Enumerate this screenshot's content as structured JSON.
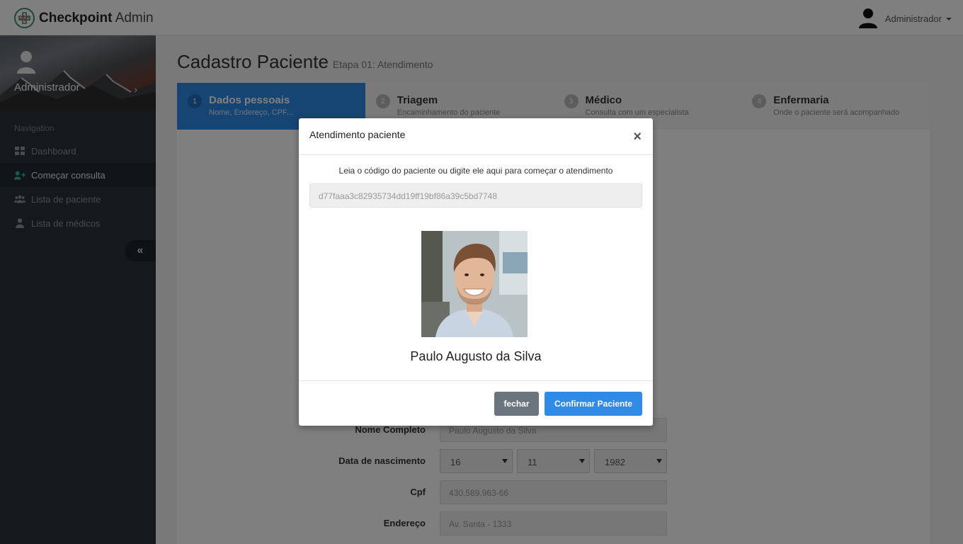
{
  "app": {
    "brand_bold": "Checkpoint",
    "brand_light": "Admin",
    "user_name": "Administrador"
  },
  "sidebar": {
    "profile_name": "Administrador",
    "nav_title": "Navigation",
    "items": [
      {
        "label": "Dashboard",
        "icon": "dashboard-icon"
      },
      {
        "label": "Começar consulta",
        "icon": "add-user-icon"
      },
      {
        "label": "Lista de paciente",
        "icon": "users-icon"
      },
      {
        "label": "Lista de médicos",
        "icon": "doctor-icon"
      }
    ]
  },
  "main": {
    "title": "Cadastro Paciente",
    "subtitle": "Etapa 01: Atendimento",
    "steps": [
      {
        "num": "1",
        "title": "Dados pessoais",
        "desc": "Nome, Endereço, CPF..."
      },
      {
        "num": "2",
        "title": "Triagem",
        "desc": "Encaminhamento do paciente"
      },
      {
        "num": "3",
        "title": "Médico",
        "desc": "Consulta com um especialista"
      },
      {
        "num": "4",
        "title": "Enfermaria",
        "desc": "Onde o paciente será acompanhado"
      }
    ],
    "form": {
      "name_label": "Nome Completo",
      "name_value": "Paulo Augusto da Silva",
      "birth_label": "Data de nascimento",
      "birth_day": "16",
      "birth_month": "11",
      "birth_year": "1982",
      "cpf_label": "Cpf",
      "cpf_value": "430.589.963-66",
      "address_label": "Endereço",
      "address_value": "Av. Santa - 1333"
    }
  },
  "modal": {
    "title": "Atendimento paciente",
    "close_symbol": "×",
    "instruction": "Leia o código do paciente ou digite ele aqui para começar o atendimento",
    "code_value": "d77faaa3c82935734dd19ff19bf86a39c5bd7748",
    "patient_name": "Paulo Augusto da Silva",
    "close_button": "fechar",
    "confirm_button": "Confirmar Paciente"
  },
  "colors": {
    "primary": "#2f8be6",
    "sidebar": "#2b3138",
    "secondary_button": "#6c757d"
  }
}
